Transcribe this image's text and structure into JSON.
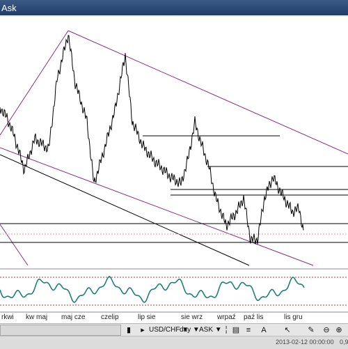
{
  "window": {
    "title": "Ask"
  },
  "x_axis_labels": [
    "rkwi",
    "kw maj",
    "maj cze",
    "czelip",
    "lip sie",
    "sie wrz",
    "wrpaź",
    "paź lis",
    "lis gru"
  ],
  "toolbar": {
    "symbol": "USD/CHF",
    "timeframe": "day",
    "price_side": "ASK",
    "dropdown_arrow": "▼"
  },
  "status": {
    "timestamp": "2013-02-12 00:00:00",
    "value": "0,9"
  },
  "colors": {
    "price_line": "#000000",
    "trend_channel": "#8a2f7a",
    "indicator": "#1e7f73",
    "indicator_band": "#b93a3a"
  },
  "icons": [
    "pin-icon",
    "cursor-icon",
    "line-icon",
    "color-icon",
    "fibonacci-icon",
    "text-icon",
    "zoom-out-icon",
    "zoom-in-icon"
  ]
}
